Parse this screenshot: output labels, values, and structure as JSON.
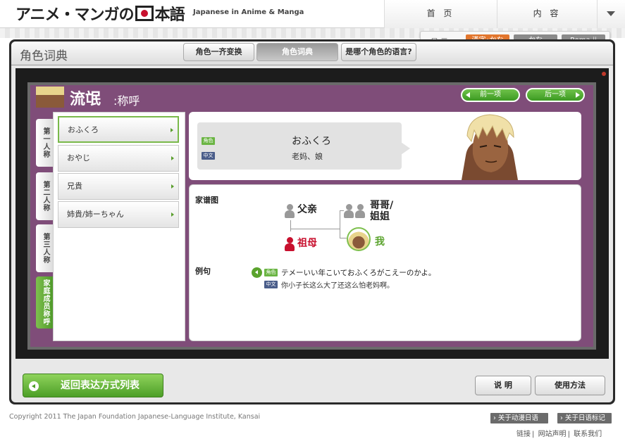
{
  "header": {
    "logo_text": "アニメ・マンガの",
    "logo_text_after": "本語",
    "logo_subtitle": "Japanese in Anime & Manga",
    "nav": [
      {
        "label": "首 页"
      },
      {
        "label": "内 容"
      }
    ]
  },
  "display": {
    "label": "显示",
    "options": [
      "漢字･かな",
      "かな",
      "Roma-ji"
    ],
    "selected": "漢字･かな",
    "active_color": "#e2762d"
  },
  "page": {
    "title": "角色词典",
    "tabs": [
      "角色一齐变换",
      "角色词典",
      "是哪个角色的语言?"
    ],
    "active_tab": "角色词典"
  },
  "character": {
    "name": "流氓",
    "subtitle": ":称呼",
    "prev_label": "前一项",
    "next_label": "后一项"
  },
  "categories": [
    {
      "label": "第一人称"
    },
    {
      "label": "第二人称"
    },
    {
      "label": "第三人称"
    },
    {
      "label": "家庭成员称呼",
      "active": true
    }
  ],
  "terms": [
    {
      "label": "おふくろ",
      "selected": true
    },
    {
      "label": "おやじ"
    },
    {
      "label": "兄貴"
    },
    {
      "label": "姉貴/姉ーちゃん"
    }
  ],
  "detail": {
    "role_tag": "角色",
    "cn_tag": "中文",
    "term": "おふくろ",
    "meaning": "老妈、娘"
  },
  "family": {
    "label": "家谱图",
    "father": "父亲",
    "grandma": "祖母",
    "siblings": "哥哥/\n姐姐",
    "me": "我"
  },
  "example": {
    "label": "例句",
    "role_tag": "角色",
    "cn_tag": "中文",
    "jp": "テメーいい年こいておふくろがこえーのかよ。",
    "cn": "你小子长这么大了还这么怕老妈啊。"
  },
  "bottom": {
    "back_label": "返回表达方式列表",
    "explain_label": "说 明",
    "howto_label": "使用方法"
  },
  "footer": {
    "copyright": "Copyright 2011 The Japan Foundation Japanese-Language Institute, Kansai",
    "btn1": "关于动漫日语",
    "btn2": "关于日语标记",
    "links": [
      "链接",
      "网站声明",
      "联系我们"
    ]
  }
}
